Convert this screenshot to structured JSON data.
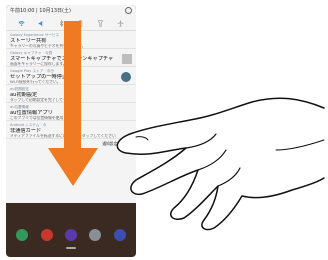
{
  "status": {
    "time": "午前10:00 | 10月13日(土)"
  },
  "quick_settings": {
    "icons": [
      "wifi-icon",
      "sound-icon",
      "bluetooth-icon",
      "rotate-icon",
      "flashlight-icon",
      "airplane-icon"
    ]
  },
  "notifications": [
    {
      "source": "Galaxy Experience サービス",
      "title": "ストーリー共有",
      "body": "ギャラリーの写真やビデオを共有できます。",
      "thumb": "none"
    },
    {
      "source": "Galaxy キャプチャ · 今週",
      "title": "スマートキャプチャでスクリーンキャプチャ",
      "body": "画面をギャラリーに保存します。",
      "thumb": "image"
    },
    {
      "source": "Google Play ストア · 今日",
      "title": "セットアップの一時停止",
      "body": "Wi-Fi接続を行ってください。",
      "thumb": "avatar"
    },
    {
      "source": "au初期設定",
      "title": "au初期設定",
      "body": "タップして初期設定を完了してください。",
      "thumb": "none"
    },
    {
      "source": "au位置情報",
      "title": "au位置情報アプリ",
      "body": "このアプリでは位置情報を使用します。",
      "thumb": "none"
    },
    {
      "source": "Android システム · 今",
      "title": "非通信カード",
      "body": "メディアファイルを転送するには、ここをタップしてください",
      "thumb": "none"
    }
  ],
  "actions": {
    "left": "通知設定",
    "right": "消去"
  },
  "dock": {
    "apps": [
      {
        "name": "phone-app",
        "color": "#2f9a5a"
      },
      {
        "name": "mail-app",
        "color": "#c8382c"
      },
      {
        "name": "browser-app",
        "color": "#5a3aa8"
      },
      {
        "name": "play-app",
        "color": "#8a8f95"
      },
      {
        "name": "camera-app",
        "color": "#3a4fb0"
      }
    ]
  },
  "colors": {
    "arrow": "#f07a22",
    "shade": "#f4f4f4",
    "wallpaper": "#3b2a22"
  }
}
